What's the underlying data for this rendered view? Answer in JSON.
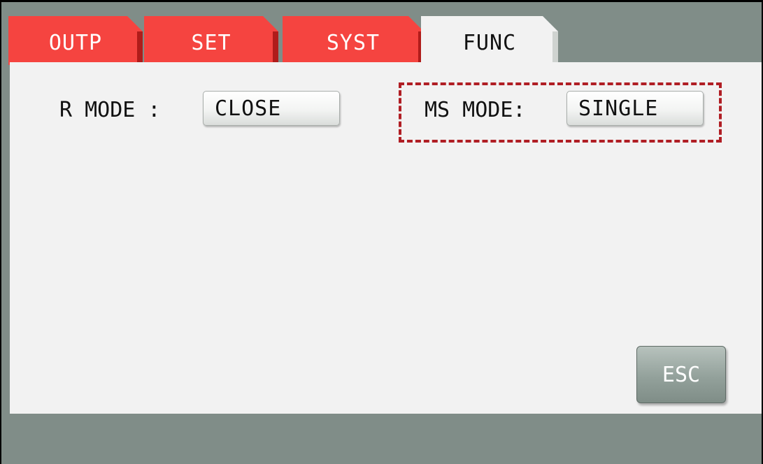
{
  "tabs": [
    {
      "label": "OUTP",
      "active": false
    },
    {
      "label": "SET",
      "active": false
    },
    {
      "label": "SYST",
      "active": false
    },
    {
      "label": "FUNC",
      "active": true
    }
  ],
  "fields": {
    "r_mode": {
      "label": "R MODE :",
      "value": "CLOSE"
    },
    "ms_mode": {
      "label": "MS MODE:",
      "value": "SINGLE"
    }
  },
  "buttons": {
    "esc": "ESC"
  },
  "colors": {
    "tab_red": "#f54440",
    "tab_red_shadow": "#b01c1a",
    "panel": "#f2f2f2",
    "frame": "#808d88",
    "highlight": "#b01e24"
  }
}
